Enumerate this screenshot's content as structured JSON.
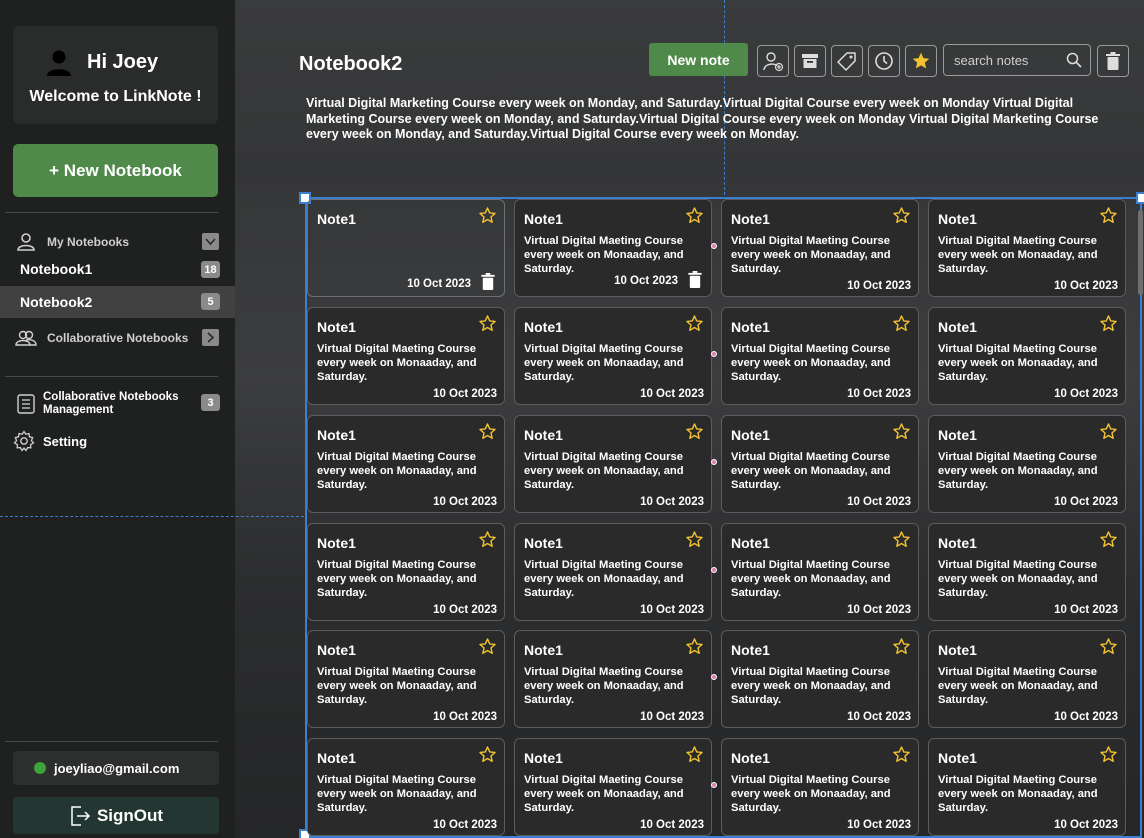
{
  "sidebar": {
    "greeting": "Hi Joey",
    "welcome": "Welcome to LinkNote !",
    "new_notebook_label": "+ New Notebook",
    "my_notebooks_label": "My Notebooks",
    "notebooks": [
      {
        "name": "Notebook1",
        "count": "18",
        "active": false
      },
      {
        "name": "Notebook2",
        "count": "5",
        "active": true
      }
    ],
    "collaborative_label": "Collaborative Notebooks",
    "collab_mgmt_label": "Collaborative Notebooks Management",
    "collab_mgmt_count": "3",
    "setting_label": "Setting",
    "email": "joeyliao@gmail.com",
    "signout_label": "SignOut"
  },
  "toolbar": {
    "new_note_label": "New note",
    "search_placeholder": "search notes",
    "icons": [
      "add-collaborator-icon",
      "archive-icon",
      "tag-icon",
      "clock-icon",
      "star-icon"
    ]
  },
  "notebook": {
    "title": "Notebook2",
    "description": "Virtual Digital Marketing Course every week on Monday,  and Saturday.Virtual Digital Course every week on Monday Virtual Digital Marketing Course every week on Monday,  and Saturday.Virtual Digital Course every week on Monday Virtual Digital Marketing Course every week on Monday,  and Saturday.Virtual Digital Course every week on Monday."
  },
  "notes": [
    {
      "title": "Note1",
      "body": "",
      "date": "10 Oct 2023"
    },
    {
      "title": "Note1",
      "body": "Virtual Digital Maeting Course every week on Monaaday,  and Saturday.",
      "date": "10 Oct 2023"
    },
    {
      "title": "Note1",
      "body": "Virtual Digital Maeting Course every week on Monaaday,  and Saturday.",
      "date": "10 Oct 2023"
    },
    {
      "title": "Note1",
      "body": "Virtual Digital Maeting Course every week on Monaaday,  and Saturday.",
      "date": "10 Oct 2023"
    },
    {
      "title": "Note1",
      "body": "Virtual Digital Maeting Course every week on Monaaday,  and Saturday.",
      "date": "10 Oct 2023"
    },
    {
      "title": "Note1",
      "body": "Virtual Digital Maeting Course every week on Monaaday,  and Saturday.",
      "date": "10 Oct 2023"
    },
    {
      "title": "Note1",
      "body": "Virtual Digital Maeting Course every week on Monaaday,  and Saturday.",
      "date": "10 Oct 2023"
    },
    {
      "title": "Note1",
      "body": "Virtual Digital Maeting Course every week on Monaaday,  and Saturday.",
      "date": "10 Oct 2023"
    },
    {
      "title": "Note1",
      "body": "Virtual Digital Maeting Course every week on Monaaday,  and Saturday.",
      "date": "10 Oct 2023"
    },
    {
      "title": "Note1",
      "body": "Virtual Digital Maeting Course every week on Monaaday,  and Saturday.",
      "date": "10 Oct 2023"
    },
    {
      "title": "Note1",
      "body": "Virtual Digital Maeting Course every week on Monaaday,  and Saturday.",
      "date": "10 Oct 2023"
    },
    {
      "title": "Note1",
      "body": "Virtual Digital Maeting Course every week on Monaaday,  and Saturday.",
      "date": "10 Oct 2023"
    },
    {
      "title": "Note1",
      "body": "Virtual Digital Maeting Course every week on Monaaday,  and Saturday.",
      "date": "10 Oct 2023"
    },
    {
      "title": "Note1",
      "body": "Virtual Digital Maeting Course every week on Monaaday,  and Saturday.",
      "date": "10 Oct 2023"
    },
    {
      "title": "Note1",
      "body": "Virtual Digital Maeting Course every week on Monaaday,  and Saturday.",
      "date": "10 Oct 2023"
    },
    {
      "title": "Note1",
      "body": "Virtual Digital Maeting Course every week on Monaaday,  and Saturday.",
      "date": "10 Oct 2023"
    },
    {
      "title": "Note1",
      "body": "Virtual Digital Maeting Course every week on Monaaday,  and Saturday.",
      "date": "10 Oct 2023"
    },
    {
      "title": "Note1",
      "body": "Virtual Digital Maeting Course every week on Monaaday,  and Saturday.",
      "date": "10 Oct 2023"
    },
    {
      "title": "Note1",
      "body": "Virtual Digital Maeting Course every week on Monaaday,  and Saturday.",
      "date": "10 Oct 2023"
    },
    {
      "title": "Note1",
      "body": "Virtual Digital Maeting Course every week on Monaaday,  and Saturday.",
      "date": "10 Oct 2023"
    },
    {
      "title": "Note1",
      "body": "Virtual Digital Maeting Course every week on Monaaday,  and Saturday.",
      "date": "10 Oct 2023"
    },
    {
      "title": "Note1",
      "body": "Virtual Digital Maeting Course every week on Monaaday,  and Saturday.",
      "date": "10 Oct 2023"
    },
    {
      "title": "Note1",
      "body": "Virtual Digital Maeting Course every week on Monaaday,  and Saturday.",
      "date": "10 Oct 2023"
    },
    {
      "title": "Note1",
      "body": "Virtual Digital Maeting Course every week on Monaaday,  and Saturday.",
      "date": "10 Oct 2023"
    }
  ],
  "colors": {
    "accent_green": "#4f8a4a",
    "star_yellow": "#f2c230",
    "selection_blue": "#3b7fd0",
    "online_green": "#3aa43a"
  }
}
